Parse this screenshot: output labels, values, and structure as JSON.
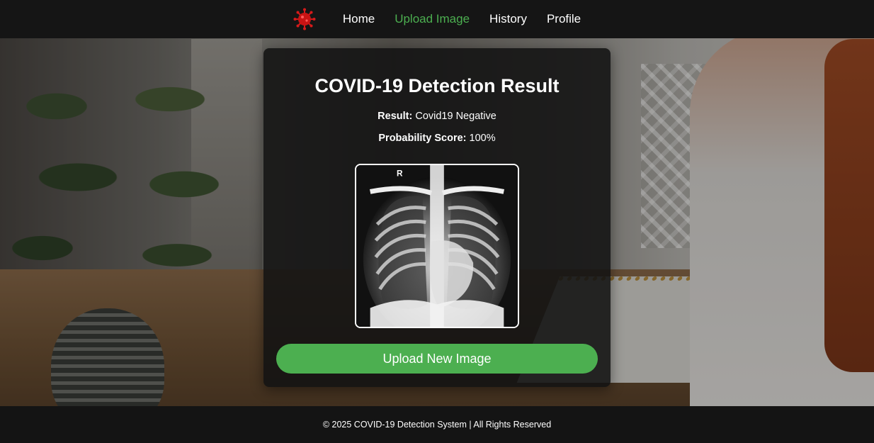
{
  "nav": {
    "logo_icon": "virus-icon",
    "items": [
      {
        "label": "Home",
        "active": false
      },
      {
        "label": "Upload Image",
        "active": true
      },
      {
        "label": "History",
        "active": false
      },
      {
        "label": "Profile",
        "active": false
      }
    ]
  },
  "result_card": {
    "title": "COVID-19 Detection Result",
    "result_label": "Result:",
    "result_value": "Covid19 Negative",
    "score_label": "Probability Score:",
    "score_value": "100%",
    "xray_marker": "R",
    "upload_button_label": "Upload New Image"
  },
  "footer": {
    "text": "© 2025 COVID-19 Detection System | All Rights Reserved"
  },
  "colors": {
    "accent": "#4caf50",
    "navbar_bg": "#151515",
    "card_bg": "rgba(18,18,18,0.88)",
    "logo_red": "#d61a1a"
  }
}
